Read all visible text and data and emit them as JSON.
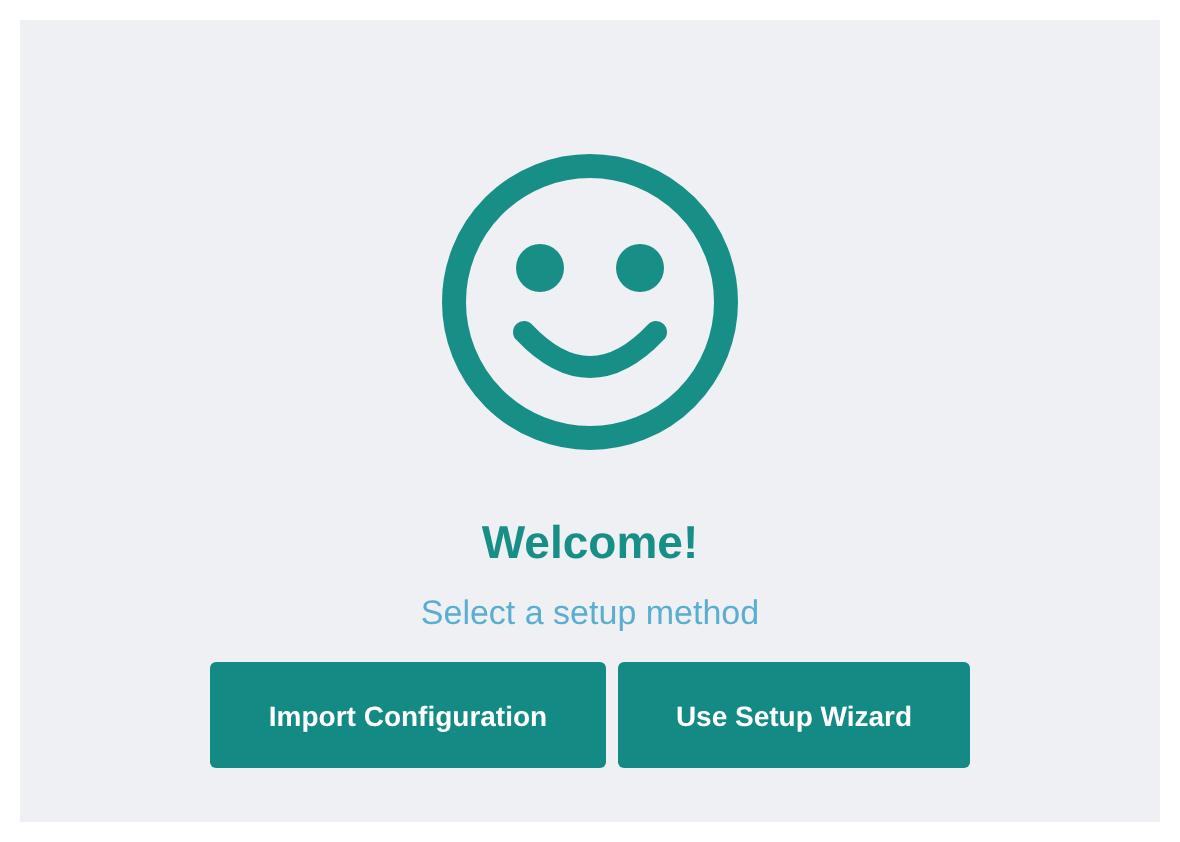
{
  "title": "Welcome!",
  "subtitle": "Select a setup method",
  "buttons": [
    {
      "label": "Import Configuration"
    },
    {
      "label": "Use Setup Wizard"
    }
  ]
}
